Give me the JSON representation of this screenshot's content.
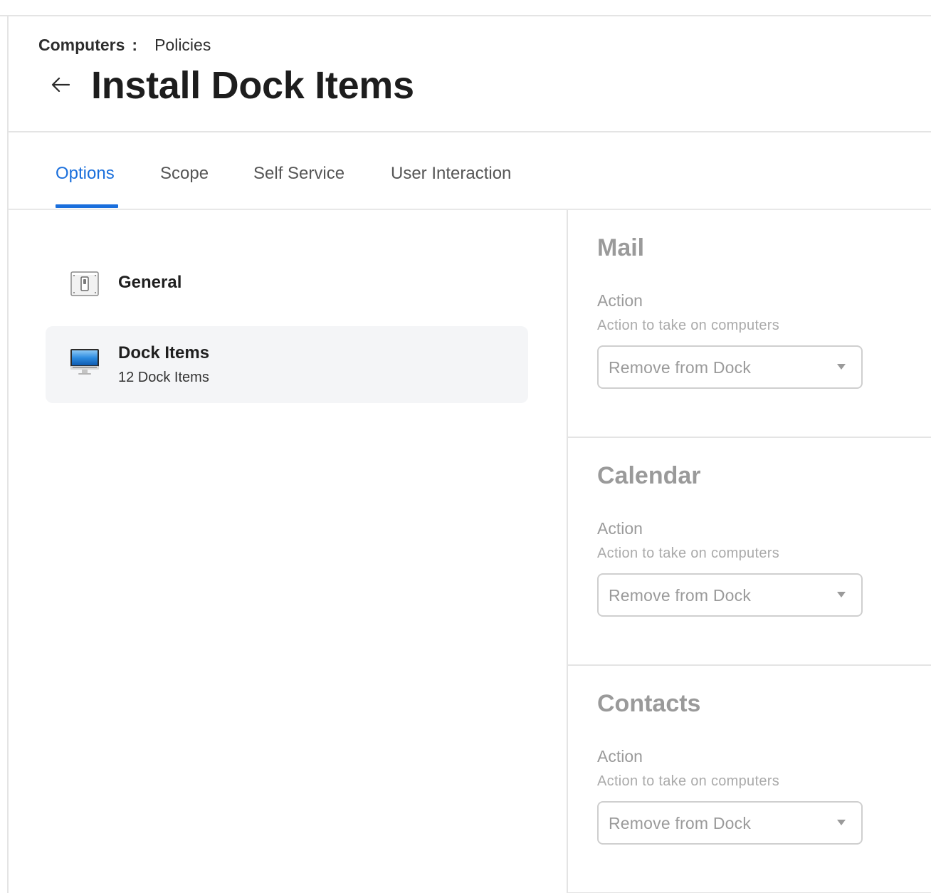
{
  "breadcrumb": {
    "parent": "Computers",
    "separator": ":",
    "current": "Policies"
  },
  "page": {
    "title": "Install Dock Items",
    "back_icon": "arrow-left-icon"
  },
  "tabs": [
    {
      "label": "Options",
      "active": true
    },
    {
      "label": "Scope",
      "active": false
    },
    {
      "label": "Self Service",
      "active": false
    },
    {
      "label": "User Interaction",
      "active": false
    }
  ],
  "colors": {
    "accent": "#1a6fdc",
    "muted_text": "#9a9a9a",
    "selected_bg": "#f4f5f7"
  },
  "nav": {
    "items": [
      {
        "label": "General",
        "icon": "switch-panel-icon",
        "selected": false
      },
      {
        "label": "Dock Items",
        "subtitle": "12 Dock Items",
        "icon": "imac-display-icon",
        "selected": true
      }
    ]
  },
  "dock_items": [
    {
      "name": "Mail",
      "field_label": "Action",
      "field_help": "Action to take on computers",
      "selected_action": "Remove from Dock"
    },
    {
      "name": "Calendar",
      "field_label": "Action",
      "field_help": "Action to take on computers",
      "selected_action": "Remove from Dock"
    },
    {
      "name": "Contacts",
      "field_label": "Action",
      "field_help": "Action to take on computers",
      "selected_action": "Remove from Dock"
    }
  ]
}
